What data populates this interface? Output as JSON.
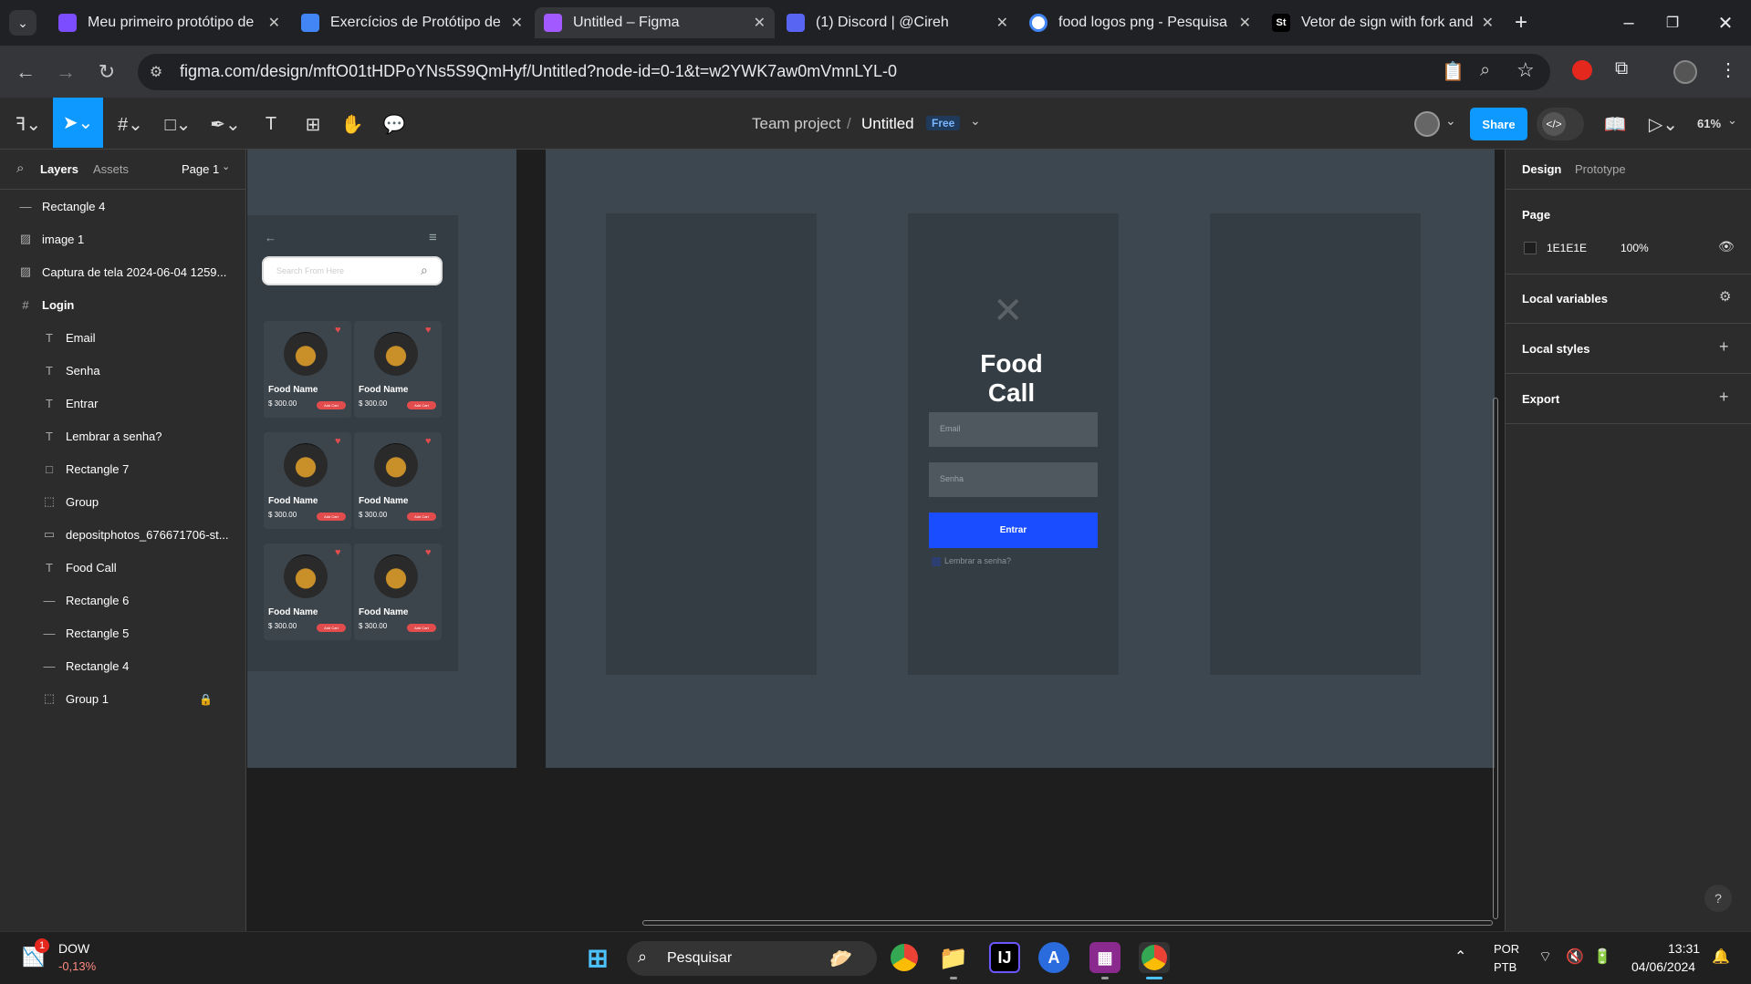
{
  "browser": {
    "tabs": [
      {
        "title": "Meu primeiro protótipo de",
        "icon": "purple-app-icon",
        "color": "#7c4dff"
      },
      {
        "title": "Exercícios de Protótipo de",
        "icon": "google-docs-icon",
        "color": "#4285f4"
      },
      {
        "title": "Untitled – Figma",
        "icon": "figma-icon",
        "color": "#a259ff"
      },
      {
        "title": "(1) Discord | @Cireh",
        "icon": "discord-icon",
        "color": "#5865f2"
      },
      {
        "title": "food logos png - Pesquisa",
        "icon": "google-icon",
        "color": "#ffffff"
      },
      {
        "title": "Vetor de sign with fork and",
        "icon": "stock-site-icon",
        "color": "#000000"
      }
    ],
    "url": "figma.com/design/mftO01tHDPoYNs5S9QmHyf/Untitled?node-id=0-1&t=w2YWK7aw0mVmnLYL-0",
    "tab_favicon_letters": {
      "stock": "St"
    }
  },
  "figma": {
    "breadcrumb_team": "Team project",
    "breadcrumb_sep": "/",
    "file_name": "Untitled",
    "plan_badge": "Free",
    "share_label": "Share",
    "zoom": "61%",
    "left_tabs": {
      "layers": "Layers",
      "assets": "Assets",
      "page": "Page 1"
    },
    "layers": [
      {
        "name": "Rectangle 4",
        "icon": "—",
        "indent": 0
      },
      {
        "name": "image 1",
        "icon": "▨",
        "indent": 0
      },
      {
        "name": "Captura de tela 2024-06-04 1259...",
        "icon": "▨",
        "indent": 0
      },
      {
        "name": "Login",
        "icon": "#",
        "indent": 0
      },
      {
        "name": "Email",
        "icon": "T",
        "indent": 1
      },
      {
        "name": "Senha",
        "icon": "T",
        "indent": 1
      },
      {
        "name": "Entrar",
        "icon": "T",
        "indent": 1
      },
      {
        "name": "Lembrar a senha?",
        "icon": "T",
        "indent": 1
      },
      {
        "name": "Rectangle 7",
        "icon": "□",
        "indent": 1
      },
      {
        "name": "Group",
        "icon": "⬚",
        "indent": 1
      },
      {
        "name": "depositphotos_676671706-st...",
        "icon": "▭",
        "indent": 1
      },
      {
        "name": "Food Call",
        "icon": "T",
        "indent": 1
      },
      {
        "name": "Rectangle 6",
        "icon": "—",
        "indent": 1
      },
      {
        "name": "Rectangle 5",
        "icon": "—",
        "indent": 1
      },
      {
        "name": "Rectangle 4",
        "icon": "—",
        "indent": 1
      },
      {
        "name": "Group 1",
        "icon": "⬚",
        "indent": 1
      }
    ],
    "right": {
      "design_tab": "Design",
      "prototype_tab": "Prototype",
      "page_heading": "Page",
      "page_color": "1E1E1E",
      "page_opacity": "100%",
      "local_variables": "Local variables",
      "local_styles": "Local styles",
      "export": "Export"
    },
    "canvas": {
      "app_title": "Food Call",
      "email_placeholder": "Email",
      "password_placeholder": "Senha",
      "login_button": "Entrar",
      "remember_label": "Lembrar a senha?",
      "search_placeholder": "Search From Here",
      "food_cards": [
        {
          "name": "Food Name",
          "price": "$ 300.00",
          "btn": "Add Cart"
        },
        {
          "name": "Food Name",
          "price": "$ 300.00",
          "btn": "Add Cart"
        },
        {
          "name": "Food Name",
          "price": "$ 300.00",
          "btn": "Add Cart"
        },
        {
          "name": "Food Name",
          "price": "$ 300.00",
          "btn": "Add Cart"
        },
        {
          "name": "Food Name",
          "price": "$ 300.00",
          "btn": "Add Cart"
        },
        {
          "name": "Food Name",
          "price": "$ 300.00",
          "btn": "Add Cart"
        }
      ]
    },
    "help": "?"
  },
  "taskbar": {
    "stock_name": "DOW",
    "stock_change": "-0,13%",
    "stock_badge": "1",
    "search_label": "Pesquisar",
    "lang_top": "POR",
    "lang_bottom": "PTB",
    "time": "13:31",
    "date": "04/06/2024"
  }
}
